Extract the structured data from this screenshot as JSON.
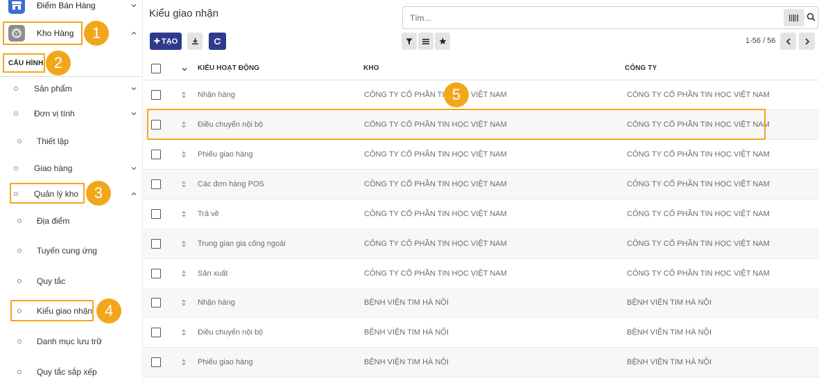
{
  "sidebar": {
    "apps": [
      {
        "label": "Điểm Bán Hàng",
        "icon": "pos-icon",
        "color": "#3b6bd6"
      },
      {
        "label": "Kho Hàng",
        "icon": "inventory-box-icon",
        "color": "#8d8d8d"
      }
    ],
    "section": "CẤU HÌNH",
    "items": [
      {
        "label": "Sản phẩm"
      },
      {
        "label": "Đơn vị tính"
      },
      {
        "label": "Thiết lập"
      },
      {
        "label": "Giao hàng"
      },
      {
        "label": "Quản lý kho"
      },
      {
        "label": "Địa điểm"
      },
      {
        "label": "Tuyến cung ứng"
      },
      {
        "label": "Quy tắc"
      },
      {
        "label": "Kiểu giao nhận"
      },
      {
        "label": "Danh mục lưu trữ"
      },
      {
        "label": "Quy tắc sắp xếp"
      }
    ]
  },
  "markers": [
    "1",
    "2",
    "3",
    "4",
    "5"
  ],
  "main": {
    "title": "Kiểu giao nhận",
    "search_placeholder": "Tìm...",
    "create_label": "TẠO",
    "pager": "1-56 / 56"
  },
  "table": {
    "columns": [
      "KIỂU HOẠT ĐỘNG",
      "KHO",
      "CÔNG TY"
    ],
    "rows": [
      {
        "type": "Nhận hàng",
        "warehouse": "CÔNG TY CỔ PHẦN TIN HỌC VIỆT NAM",
        "company": "CÔNG TY CỔ PHẦN TIN HỌC VIỆT NAM"
      },
      {
        "type": "Điều chuyển nội bộ",
        "warehouse": "CÔNG TY CỔ PHẦN TIN HỌC VIỆT NAM",
        "company": "CÔNG TY CỔ PHẦN TIN HỌC VIỆT NAM"
      },
      {
        "type": "Phiếu giao hàng",
        "warehouse": "CÔNG TY CỔ PHẦN TIN HỌC VIỆT NAM",
        "company": "CÔNG TY CỔ PHẦN TIN HỌC VIỆT NAM"
      },
      {
        "type": "Các đơn hàng POS",
        "warehouse": "CÔNG TY CỔ PHẦN TIN HỌC VIỆT NAM",
        "company": "CÔNG TY CỔ PHẦN TIN HỌC VIỆT NAM"
      },
      {
        "type": "Trả về",
        "warehouse": "CÔNG TY CỔ PHẦN TIN HỌC VIỆT NAM",
        "company": "CÔNG TY CỔ PHẦN TIN HỌC VIỆT NAM"
      },
      {
        "type": "Trung gian gia công ngoài",
        "warehouse": "CÔNG TY CỔ PHẦN TIN HỌC VIỆT NAM",
        "company": "CÔNG TY CỔ PHẦN TIN HỌC VIỆT NAM"
      },
      {
        "type": "Sản xuất",
        "warehouse": "CÔNG TY CỔ PHẦN TIN HỌC VIỆT NAM",
        "company": "CÔNG TY CỔ PHẦN TIN HỌC VIỆT NAM"
      },
      {
        "type": "Nhận hàng",
        "warehouse": "BỆNH VIỆN TIM HÀ NỘI",
        "company": "BỆNH VIỆN TIM HÀ NỘI"
      },
      {
        "type": "Điều chuyển nội bộ",
        "warehouse": "BỆNH VIỆN TIM HÀ NỘI",
        "company": "BỆNH VIỆN TIM HÀ NỘI"
      },
      {
        "type": "Phiếu giao hàng",
        "warehouse": "BỆNH VIỆN TIM HÀ NỘI",
        "company": "BỆNH VIỆN TIM HÀ NỘI"
      }
    ]
  },
  "colors": {
    "primary": "#2f3a8f",
    "highlight": "#f2a71b"
  }
}
